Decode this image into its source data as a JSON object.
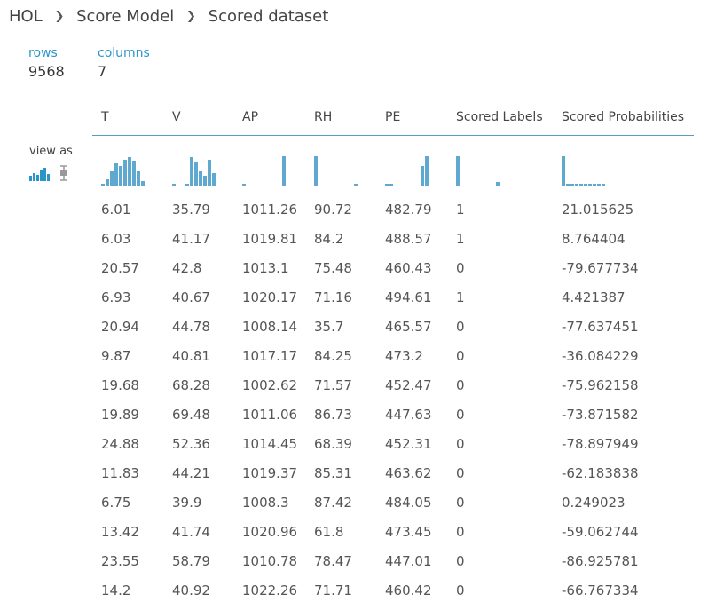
{
  "breadcrumb": {
    "items": [
      "HOL",
      "Score Model",
      "Scored dataset"
    ]
  },
  "summary": {
    "rows_label": "rows",
    "rows_value": "9568",
    "columns_label": "columns",
    "columns_value": "7"
  },
  "view_as": {
    "label": "view as",
    "options": [
      "histogram-icon",
      "boxplot-icon"
    ]
  },
  "colors": {
    "accent": "#2a95c9",
    "bar": "#5fa8cf",
    "header_rule": "#5a9cc1"
  },
  "table": {
    "columns": [
      "T",
      "V",
      "AP",
      "RH",
      "PE",
      "Scored Labels",
      "Scored Probabilities"
    ],
    "histograms": [
      [
        0.05,
        0.2,
        0.45,
        0.7,
        0.6,
        0.8,
        0.9,
        0.78,
        0.45,
        0.15
      ],
      [
        0.05,
        0,
        0,
        0.05,
        0.9,
        0.75,
        0.45,
        0.3,
        0.8,
        0.4
      ],
      [
        0.05,
        0,
        0,
        0,
        0,
        0,
        0,
        0,
        0,
        0.92
      ],
      [
        0.92,
        0,
        0,
        0,
        0,
        0,
        0,
        0,
        0,
        0.02
      ],
      [
        0.03,
        0.03,
        0,
        0,
        0,
        0,
        0,
        0,
        0.6,
        0.92
      ],
      [
        0.92,
        0,
        0,
        0,
        0,
        0,
        0,
        0,
        0,
        0.1
      ],
      [
        0.92,
        0.05,
        0.05,
        0.03,
        0.03,
        0.03,
        0.02,
        0.02,
        0.02,
        0.02
      ]
    ],
    "rows": [
      [
        "6.01",
        "35.79",
        "1011.26",
        "90.72",
        "482.79",
        "1",
        "21.015625"
      ],
      [
        "6.03",
        "41.17",
        "1019.81",
        "84.2",
        "488.57",
        "1",
        "8.764404"
      ],
      [
        "20.57",
        "42.8",
        "1013.1",
        "75.48",
        "460.43",
        "0",
        "-79.677734"
      ],
      [
        "6.93",
        "40.67",
        "1020.17",
        "71.16",
        "494.61",
        "1",
        "4.421387"
      ],
      [
        "20.94",
        "44.78",
        "1008.14",
        "35.7",
        "465.57",
        "0",
        "-77.637451"
      ],
      [
        "9.87",
        "40.81",
        "1017.17",
        "84.25",
        "473.2",
        "0",
        "-36.084229"
      ],
      [
        "19.68",
        "68.28",
        "1002.62",
        "71.57",
        "452.47",
        "0",
        "-75.962158"
      ],
      [
        "19.89",
        "69.48",
        "1011.06",
        "86.73",
        "447.63",
        "0",
        "-73.871582"
      ],
      [
        "24.88",
        "52.36",
        "1014.45",
        "68.39",
        "452.31",
        "0",
        "-78.897949"
      ],
      [
        "11.83",
        "44.21",
        "1019.37",
        "85.31",
        "463.62",
        "0",
        "-62.183838"
      ],
      [
        "6.75",
        "39.9",
        "1008.3",
        "87.42",
        "484.05",
        "0",
        "0.249023"
      ],
      [
        "13.42",
        "41.74",
        "1020.96",
        "61.8",
        "473.45",
        "0",
        "-59.062744"
      ],
      [
        "23.55",
        "58.79",
        "1010.78",
        "78.47",
        "447.01",
        "0",
        "-86.925781"
      ],
      [
        "14.2",
        "40.92",
        "1022.26",
        "71.71",
        "460.42",
        "0",
        "-66.767334"
      ]
    ]
  }
}
